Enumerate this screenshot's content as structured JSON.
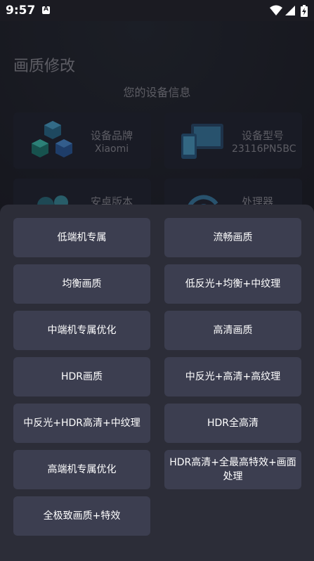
{
  "status": {
    "time": "9:57"
  },
  "page": {
    "title": "画质修改",
    "section_title": "您的设备信息",
    "cards": [
      {
        "label": "设备品牌",
        "value": "Xiaomi",
        "icon": "cubes-icon"
      },
      {
        "label": "设备型号",
        "value": "23116PN5BC",
        "icon": "devices-icon"
      },
      {
        "label": "安卓版本",
        "value": "",
        "icon": "android-icon"
      },
      {
        "label": "处理器",
        "value": "",
        "icon": "processor-icon"
      }
    ]
  },
  "sheet": {
    "options": [
      "低端机专属",
      "流畅画质",
      "均衡画质",
      "低反光+均衡+中纹理",
      "中端机专属优化",
      "高清画质",
      "HDR画质",
      "中反光+高清+高纹理",
      "中反光+HDR高清+中纹理",
      "HDR全高清",
      "高端机专属优化",
      "HDR高清+全最高特效+画面处理",
      "全极致画质+特效"
    ]
  },
  "colors": {
    "background": "#1b1b22",
    "sheet": "#2c2d38",
    "button": "#3c3e50",
    "text_muted": "#8a8a93"
  }
}
